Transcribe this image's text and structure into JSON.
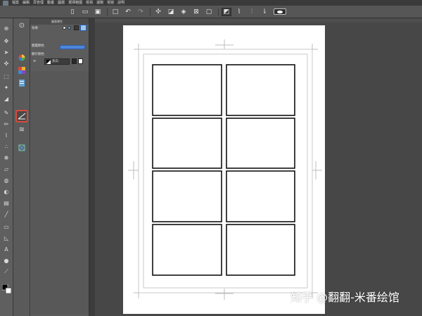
{
  "menubar": {
    "items": [
      "檔案",
      "編輯",
      "頁管理",
      "動畫",
      "圖層",
      "選擇範圍",
      "檢視",
      "濾鏡",
      "視窗",
      "說明"
    ]
  },
  "command_bar": {
    "icons": [
      "new-file-icon",
      "open-icon",
      "save-icon",
      "undo-icon",
      "redo-icon",
      "transform-icon",
      "fill-icon",
      "clear-icon",
      "fill-selection-icon",
      "snap-icon",
      "snap-ruler-icon",
      "snap-grid-icon",
      "toggle-icon"
    ]
  },
  "tool_property": {
    "header": "圖層屬性",
    "effect_label": "效果",
    "layer_color_label": "圖層顏色",
    "display_color_label": "顯示顏色",
    "color_mode_value": "黑白",
    "accent_color": "#4f86d9"
  },
  "subtool": {
    "selected": "frame-border-tool-icon",
    "highlight_color": "#d94a3e"
  },
  "canvas": {
    "page_color": "#ffffff",
    "panel_rows": 4,
    "panel_cols": 2
  },
  "watermark": {
    "text": "知乎 @翻翻-米番绘馆"
  }
}
